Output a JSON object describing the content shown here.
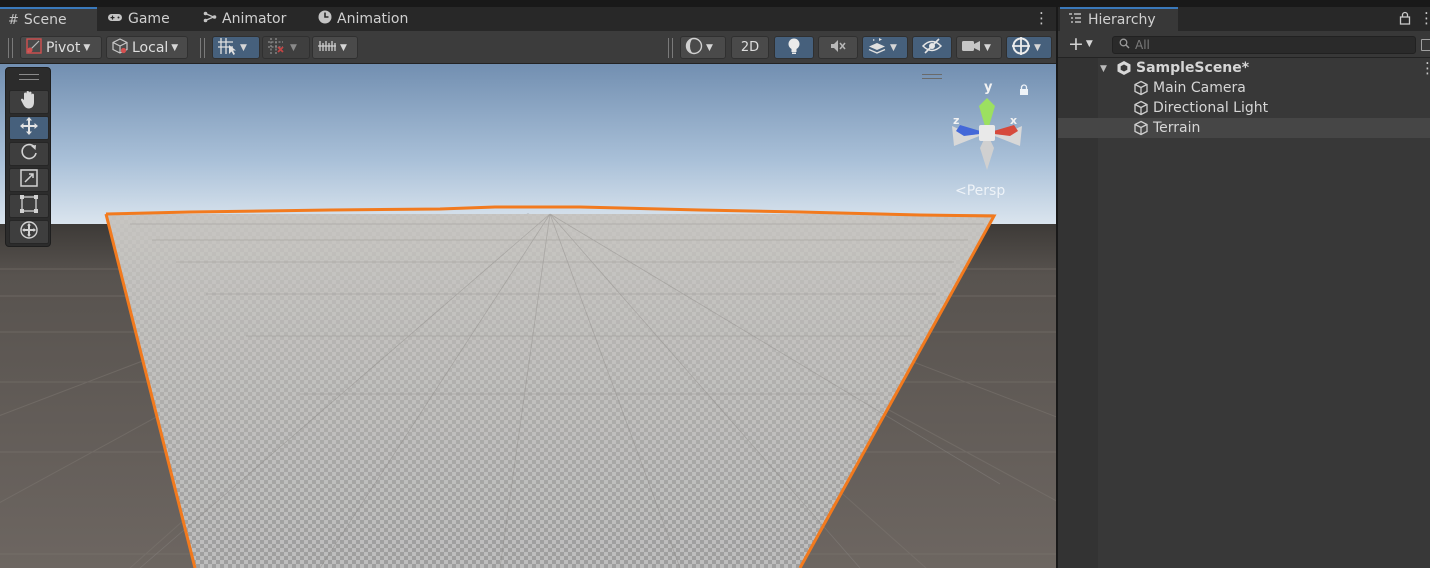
{
  "scene_tabs": [
    {
      "label": "Scene",
      "icon": "grid-icon"
    },
    {
      "label": "Game",
      "icon": "gamepad-icon"
    },
    {
      "label": "Animator",
      "icon": "animator-icon"
    },
    {
      "label": "Animation",
      "icon": "clock-icon"
    }
  ],
  "toolbar": {
    "pivot_label": "Pivot",
    "local_label": "Local",
    "mode_2d_label": "2D"
  },
  "tools": [
    "hand-tool",
    "move-tool",
    "rotate-tool",
    "scale-tool",
    "rect-tool",
    "transform-tool"
  ],
  "gizmo": {
    "y_label": "y",
    "x_label": "x",
    "z_label": "z",
    "projection_label": "Persp"
  },
  "hierarchy": {
    "tab_label": "Hierarchy",
    "search_placeholder": "All",
    "scene_name": "SampleScene*",
    "objects": [
      "Main Camera",
      "Directional Light",
      "Terrain"
    ]
  },
  "colors": {
    "selection_outline": "#f27a1e",
    "accent_tab": "#3a79bb",
    "toggle_on": "#46607c"
  }
}
